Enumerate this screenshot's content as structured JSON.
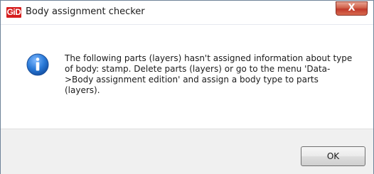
{
  "window": {
    "title": "Body assignment checker",
    "logo_text": "GiD",
    "close_glyph": "X"
  },
  "dialog": {
    "icon": "info-icon",
    "message": "The following parts (layers) hasn't assigned information about type of body: stamp. Delete parts (layers) or go to the menu 'Data->Body assignment edition' and assign a body type to parts (layers).",
    "ok_label": "OK"
  },
  "colors": {
    "logo_red": "#d61e1e",
    "close_red": "#c0392b",
    "footer_gray": "#f0f0f0",
    "info_blue": "#1d6fcf"
  }
}
